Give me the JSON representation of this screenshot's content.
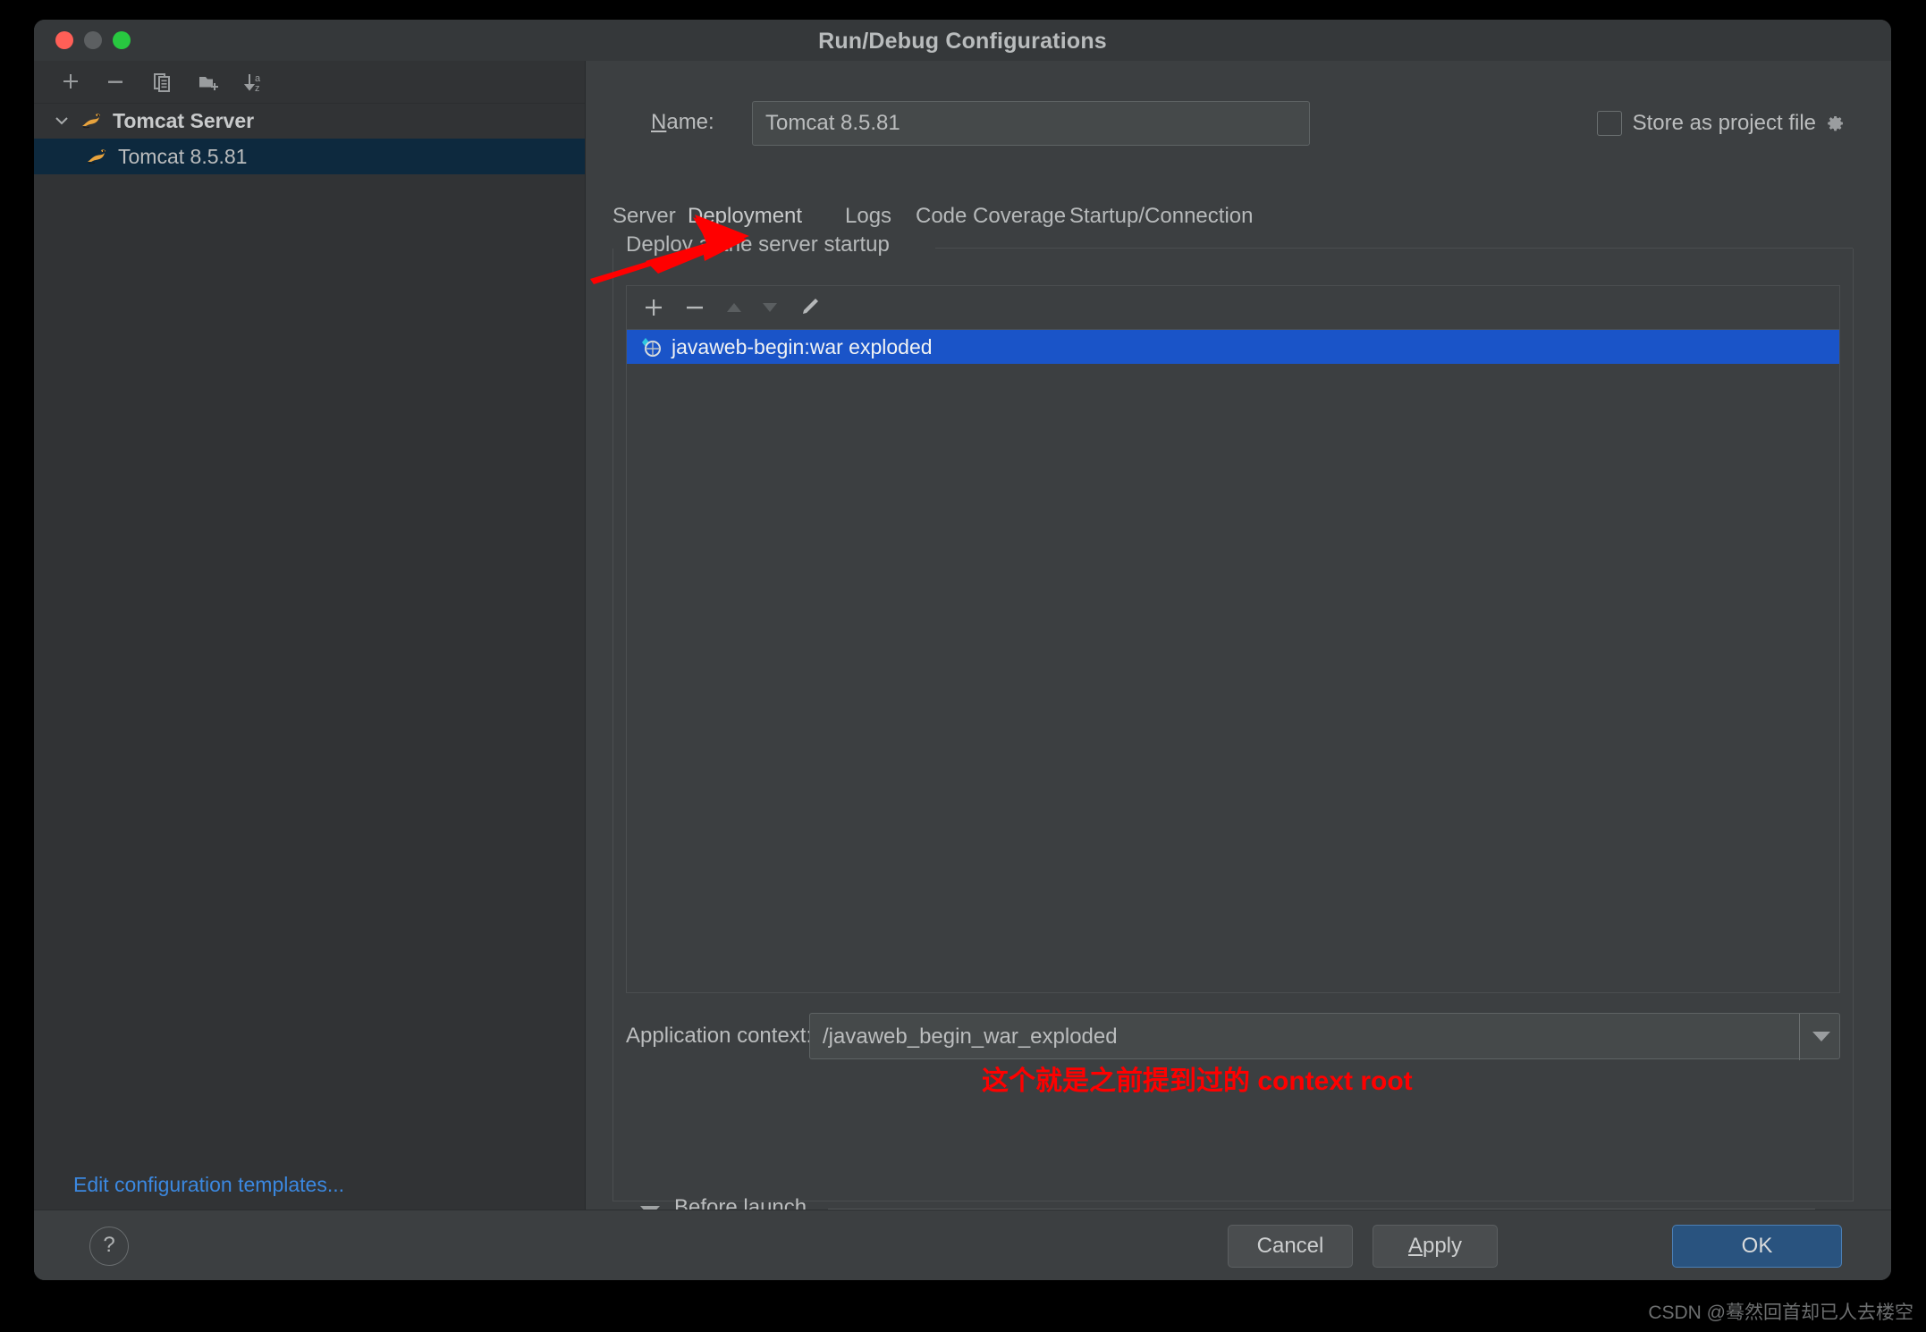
{
  "window": {
    "title": "Run/Debug Configurations",
    "traffic_lights": [
      "close",
      "minimize",
      "zoom"
    ]
  },
  "sidebar": {
    "toolbar": [
      {
        "name": "add-configuration",
        "icon": "plus-icon"
      },
      {
        "name": "remove-configuration",
        "icon": "minus-icon"
      },
      {
        "name": "copy-configuration",
        "icon": "copy-icon"
      },
      {
        "name": "new-folder",
        "icon": "new-folder-icon"
      },
      {
        "name": "sort-configurations",
        "icon": "sort-az-icon"
      }
    ],
    "tree": [
      {
        "label": "Tomcat Server",
        "type": "group",
        "expanded": true,
        "selected": false
      },
      {
        "label": "Tomcat 8.5.81",
        "type": "item",
        "selected": true
      }
    ],
    "edit_templates_link": "Edit configuration templates..."
  },
  "main": {
    "name_label": "Name:",
    "name_value": "Tomcat 8.5.81",
    "store_as_project_file": {
      "label": "Store as project file",
      "checked": false,
      "gear_icon": "gear-icon"
    },
    "tabs": [
      {
        "label": "Server",
        "active": false
      },
      {
        "label": "Deployment",
        "active": true
      },
      {
        "label": "Logs",
        "active": false
      },
      {
        "label": "Code Coverage",
        "active": false
      },
      {
        "label": "Startup/Connection",
        "active": false
      }
    ],
    "deploy_group_title": "Deploy at the server startup",
    "deploy_toolbar": [
      {
        "name": "add-artifact",
        "icon": "plus-icon",
        "enabled": true
      },
      {
        "name": "remove-artifact",
        "icon": "minus-icon",
        "enabled": true
      },
      {
        "name": "move-up",
        "icon": "arrow-up-icon",
        "enabled": false
      },
      {
        "name": "move-down",
        "icon": "arrow-down-icon",
        "enabled": false
      },
      {
        "name": "edit-artifact",
        "icon": "pencil-icon",
        "enabled": true
      }
    ],
    "deploy_items": [
      {
        "label": "javaweb-begin:war exploded",
        "selected": true,
        "icon": "artifact-icon"
      }
    ],
    "application_context": {
      "label": "Application context:",
      "value": "/javaweb_begin_war_exploded",
      "dropdown_icon": "chevron-down-icon"
    },
    "before_launch": {
      "label": "Before launch",
      "expanded": true,
      "toggle_icon": "triangle-down-icon"
    }
  },
  "footer": {
    "help_label": "?",
    "cancel_label": "Cancel",
    "apply_label": "Apply",
    "ok_label": "OK"
  },
  "annotations": {
    "red_text": "这个就是之前提到过的 context root",
    "red_arrow_target": "Deployment tab",
    "watermark": "CSDN @蓦然回首却已人去楼空"
  },
  "colors": {
    "accent_blue": "#3e7ed0",
    "selection_blue": "#1a54c8",
    "tree_selection": "#0d293e",
    "ok_button": "#29537f",
    "link_blue": "#3b88e0",
    "annotation_red": "#ff0000",
    "window_bg": "#3c3f41",
    "sidebar_bg": "#313335"
  }
}
